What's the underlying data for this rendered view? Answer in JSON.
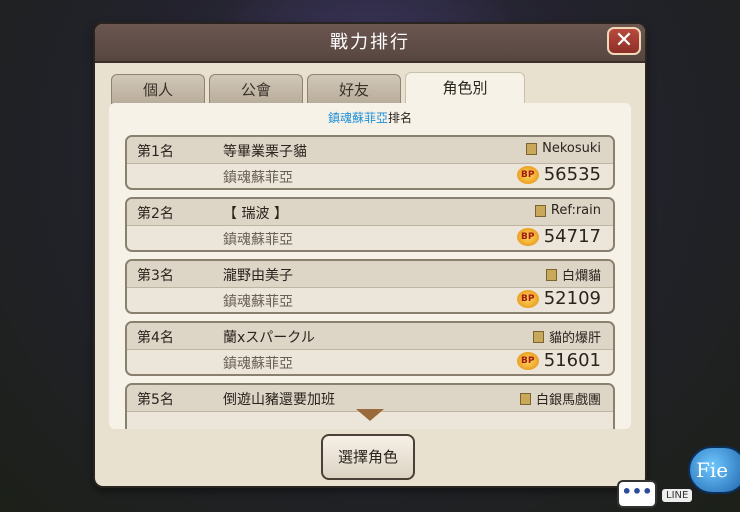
{
  "window": {
    "title": "戰力排行",
    "close_label": "✕"
  },
  "tabs": [
    {
      "label": "個人"
    },
    {
      "label": "公會"
    },
    {
      "label": "好友"
    },
    {
      "label": "角色別",
      "active": true
    }
  ],
  "subtitle": {
    "character": "鎮魂蘇菲亞",
    "suffix": "排名"
  },
  "rankings": [
    {
      "rank": "第1名",
      "name": "等畢業栗子貓",
      "guild": "Nekosuki",
      "character": "鎮魂蘇菲亞",
      "bp": "56535"
    },
    {
      "rank": "第2名",
      "name": "【 瑞波 】",
      "guild": "Ref:rain",
      "character": "鎮魂蘇菲亞",
      "bp": "54717"
    },
    {
      "rank": "第3名",
      "name": "瀧野由美子",
      "guild": "白爛貓",
      "character": "鎮魂蘇菲亞",
      "bp": "52109"
    },
    {
      "rank": "第4名",
      "name": "蘭xスパークル",
      "guild": "貓的爆肝",
      "character": "鎮魂蘇菲亞",
      "bp": "51601"
    },
    {
      "rank": "第5名",
      "name": "倒遊山豬還要加班",
      "guild": "白銀馬戲團",
      "character": "",
      "bp": ""
    }
  ],
  "bp_label": "BP",
  "select_button": "選擇角色",
  "chat": {
    "dots": "•••",
    "line_label": "LINE"
  },
  "field_label": "Fie"
}
